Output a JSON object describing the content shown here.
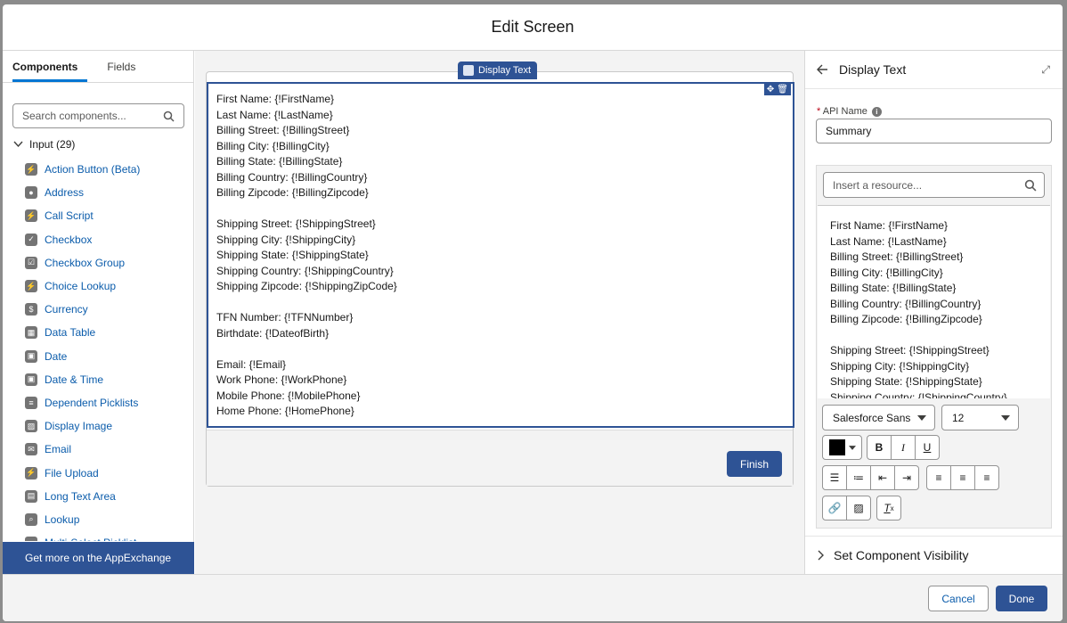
{
  "modal": {
    "title": "Edit Screen"
  },
  "left": {
    "tabs": [
      "Components",
      "Fields"
    ],
    "search_placeholder": "Search components...",
    "group": "Input (29)",
    "items": [
      {
        "label": "Action Button (Beta)",
        "icon": "bolt-icon",
        "glyph": "⚡"
      },
      {
        "label": "Address",
        "icon": "location-icon",
        "glyph": "●"
      },
      {
        "label": "Call Script",
        "icon": "bolt-icon",
        "glyph": "⚡"
      },
      {
        "label": "Checkbox",
        "icon": "checkbox-icon",
        "glyph": "✓"
      },
      {
        "label": "Checkbox Group",
        "icon": "checkbox-group-icon",
        "glyph": "☑"
      },
      {
        "label": "Choice Lookup",
        "icon": "bolt-icon",
        "glyph": "⚡"
      },
      {
        "label": "Currency",
        "icon": "currency-icon",
        "glyph": "$"
      },
      {
        "label": "Data Table",
        "icon": "table-icon",
        "glyph": "▦"
      },
      {
        "label": "Date",
        "icon": "calendar-icon",
        "glyph": "▣"
      },
      {
        "label": "Date & Time",
        "icon": "calendar-time-icon",
        "glyph": "▣"
      },
      {
        "label": "Dependent Picklists",
        "icon": "list-icon",
        "glyph": "≡"
      },
      {
        "label": "Display Image",
        "icon": "image-icon",
        "glyph": "▨"
      },
      {
        "label": "Email",
        "icon": "email-icon",
        "glyph": "✉"
      },
      {
        "label": "File Upload",
        "icon": "bolt-icon",
        "glyph": "⚡"
      },
      {
        "label": "Long Text Area",
        "icon": "text-area-icon",
        "glyph": "▤"
      },
      {
        "label": "Lookup",
        "icon": "lookup-icon",
        "glyph": "⌕"
      },
      {
        "label": "Multi-Select Picklist",
        "icon": "list-icon",
        "glyph": "≡"
      }
    ],
    "appexchange": "Get more on the AppExchange"
  },
  "canvas": {
    "component_label": "Display Text",
    "text": "First Name: {!FirstName}\nLast Name: {!LastName}\nBilling Street: {!BillingStreet}\nBilling City: {!BillingCity}\nBilling State: {!BillingState}\nBilling Country: {!BillingCountry}\nBilling Zipcode: {!BillingZipcode}\n\nShipping Street: {!ShippingStreet}\nShipping City: {!ShippingCity}\nShipping State: {!ShippingState}\nShipping Country: {!ShippingCountry}\nShipping Zipcode: {!ShippingZipCode}\n\nTFN Number: {!TFNNumber}\nBirthdate: {!DateofBirth}\n\nEmail: {!Email}\nWork Phone: {!WorkPhone}\nMobile Phone: {!MobilePhone}\nHome Phone: {!HomePhone}",
    "finish_label": "Finish"
  },
  "right": {
    "title": "Display Text",
    "api_label": "API Name",
    "api_value": "Summary",
    "resource_placeholder": "Insert a resource...",
    "editor_text": "First Name: {!FirstName}\nLast Name: {!LastName}\nBilling Street: {!BillingStreet}\nBilling City: {!BillingCity}\nBilling State: {!BillingState}\nBilling Country: {!BillingCountry}\nBilling Zipcode: {!BillingZipcode}\n\nShipping Street: {!ShippingStreet}\nShipping City: {!ShippingCity}\nShipping State: {!ShippingState}\nShipping Country: {!ShippingCountry}",
    "font_family": "Salesforce Sans",
    "font_size": "12",
    "visibility": "Set Component Visibility"
  },
  "footer": {
    "cancel": "Cancel",
    "done": "Done"
  },
  "colors": {
    "brand": "#2e5395",
    "link": "#0b5cab"
  }
}
